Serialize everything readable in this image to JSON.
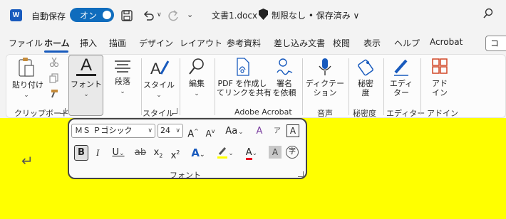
{
  "titlebar": {
    "app_icon": "W",
    "autosave_label": "自動保存",
    "toggle_label": "オン",
    "save_icon": "save-icon",
    "undo_icon": "undo-icon",
    "redo_icon": "redo-icon",
    "doc_title": "文書1.docx",
    "doc_status": "制限なし • 保存済み ∨",
    "search_icon": "search-icon"
  },
  "tabs": [
    "ファイル",
    "ホーム",
    "挿入",
    "描画",
    "デザイン",
    "レイアウト",
    "参考資料",
    "差し込み文書",
    "校閲",
    "表示",
    "ヘルプ",
    "Acrobat"
  ],
  "active_tab": "ホーム",
  "comment_label": "コ",
  "ribbon": {
    "paste_label": "貼り付け",
    "clipboard_group": "クリップボード",
    "font_label": "フォント",
    "paragraph_label": "段落",
    "style_label": "スタイル",
    "style_group": "スタイル",
    "edit_label": "編集",
    "pdf_label_1": "PDF を作成し",
    "pdf_label_2": "てリンクを共有",
    "sign_label_1": "署名",
    "sign_label_2": "を依頼",
    "acrobat_group": "Adobe Acrobat",
    "dictate_label_1": "ディクテー",
    "dictate_label_2": "ション",
    "voice_group": "音声",
    "sensitivity_label_1": "秘密",
    "sensitivity_label_2": "度",
    "sensitivity_group": "秘密度",
    "editor_label_1": "エディ",
    "editor_label_2": "ター",
    "editor_group": "エディター",
    "addin_label_1": "アド",
    "addin_label_2": "イン",
    "addin_group": "アドイン"
  },
  "font_panel": {
    "font_name": "ＭＳ Ｐゴシック",
    "font_size": "24",
    "grow": "A",
    "shrink": "A",
    "case": "Aa",
    "bold": "B",
    "italic": "I",
    "underline": "U",
    "strike": "ab",
    "subscript": "x",
    "superscript": "x",
    "sub_mark": "2",
    "sup_mark": "2",
    "text_effect": "A",
    "highlight": "ab",
    "font_color": "A",
    "char_shade": "A",
    "enclose": "字",
    "border_char": "A",
    "phonetic": "ア",
    "group_label": "フォント"
  },
  "colors": {
    "accent": "#185abd",
    "document_bg": "#ffff00",
    "highlight": "#ffff00",
    "font_color": "#e81123"
  }
}
